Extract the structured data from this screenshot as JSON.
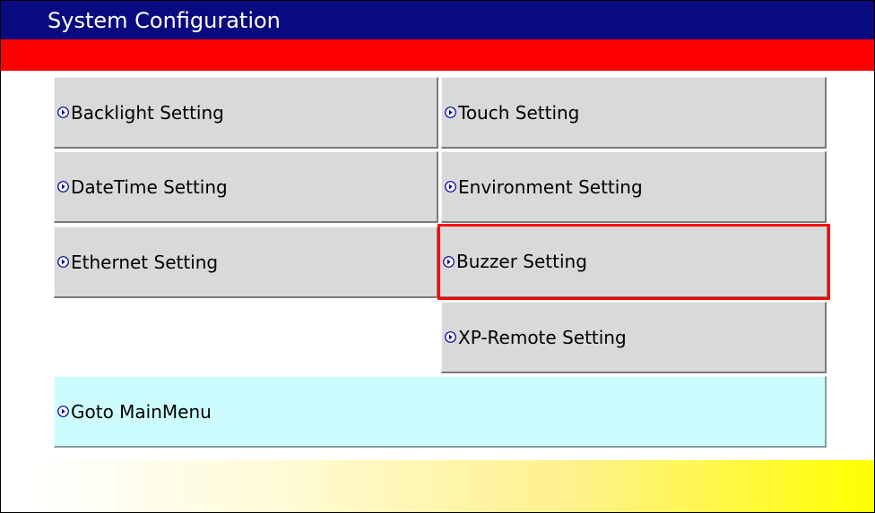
{
  "window": {
    "title": "System Configuration"
  },
  "menu": {
    "backlight": "Backlight Setting",
    "touch": "Touch Setting",
    "datetime": "DateTime Setting",
    "environment": "Environment Setting",
    "ethernet": "Ethernet Setting",
    "buzzer": "Buzzer Setting",
    "xp_remote": "XP-Remote Setting",
    "goto_main": "Goto MainMenu"
  },
  "selected_item": "Buzzer Setting",
  "icons": {
    "menu_item_icon": "right-arrow-circle-icon"
  },
  "colors": {
    "title_bar": "#0a0a80",
    "header_band": "#ff0000",
    "button_face": "#d9d9d9",
    "goto_button_face": "#ccfcfe",
    "selection_outline": "#ff0000",
    "footer_gradient_end": "#ffff00"
  }
}
